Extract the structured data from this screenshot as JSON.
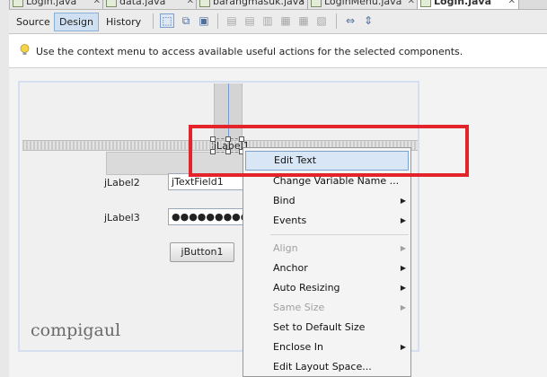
{
  "file_tabs": [
    {
      "label": "Login.java",
      "active": false
    },
    {
      "label": "data.java",
      "active": false
    },
    {
      "label": "barangmasuk.java",
      "active": false
    },
    {
      "label": "LoginMenu.java",
      "active": false
    },
    {
      "label": "Login.java",
      "active": true
    }
  ],
  "view_tabs": [
    {
      "label": "Source",
      "active": false
    },
    {
      "label": "Design",
      "active": true
    },
    {
      "label": "History",
      "active": false
    }
  ],
  "toolbar_icons": [
    "selection-mode-icon",
    "connection-mode-icon",
    "preview-design-icon",
    "align-left-icon",
    "align-right-icon",
    "center-horizontally-icon",
    "align-top-icon",
    "align-bottom-icon",
    "center-vertically-icon",
    "horizontal-resize-icon",
    "vertical-resize-icon"
  ],
  "hint": {
    "text": "Use the context menu to access available useful actions for the selected components."
  },
  "form": {
    "selected_label": "jLabel1",
    "label2": "jLabel2",
    "textfield1": "jTextField1",
    "label3": "jLabel3",
    "password": "●●●●●●●●●●●",
    "button1": "jButton1"
  },
  "watermark": "compigaul",
  "context_menu": {
    "items": [
      {
        "label": "Edit Text",
        "enabled": true,
        "submenu": false,
        "highlighted": true
      },
      {
        "label": "Change Variable Name ...",
        "enabled": true,
        "submenu": false,
        "highlighted": false
      },
      {
        "label": "Bind",
        "enabled": true,
        "submenu": true,
        "highlighted": false
      },
      {
        "label": "Events",
        "enabled": true,
        "submenu": true,
        "highlighted": false
      },
      {
        "label": "Align",
        "enabled": false,
        "submenu": true,
        "highlighted": false
      },
      {
        "label": "Anchor",
        "enabled": true,
        "submenu": true,
        "highlighted": false
      },
      {
        "label": "Auto Resizing",
        "enabled": true,
        "submenu": true,
        "highlighted": false
      },
      {
        "label": "Same Size",
        "enabled": false,
        "submenu": true,
        "highlighted": false
      },
      {
        "label": "Set to Default Size",
        "enabled": true,
        "submenu": false,
        "highlighted": false
      },
      {
        "label": "Enclose In",
        "enabled": true,
        "submenu": true,
        "highlighted": false
      },
      {
        "label": "Edit Layout Space...",
        "enabled": true,
        "submenu": false,
        "highlighted": false
      }
    ]
  },
  "colors": {
    "highlight_box": "#e3242b",
    "menu_hover": "#d8e6f5",
    "design_tab": "#cfe0f3"
  }
}
